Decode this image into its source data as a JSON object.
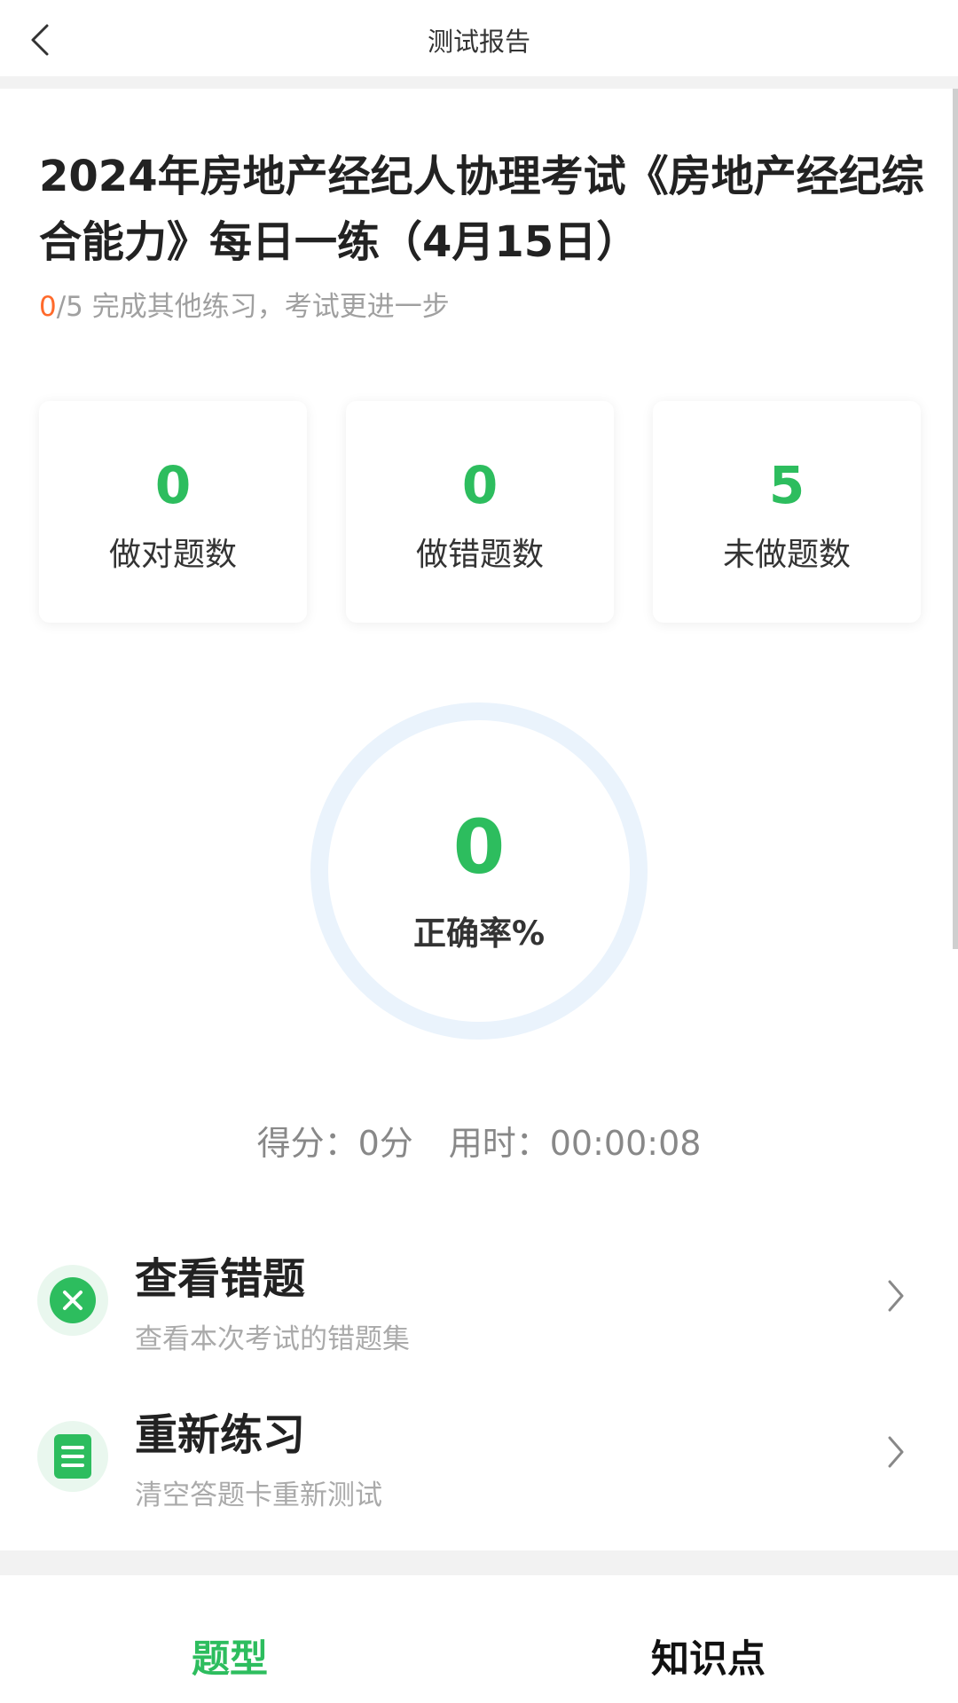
{
  "header": {
    "title": "测试报告"
  },
  "exam": {
    "title": "2024年房地产经纪人协理考试《房地产经纪综合能力》每日一练（4月15日）",
    "progress_done": "0",
    "progress_rest": "/5 完成其他练习，考试更进一步"
  },
  "stats": [
    {
      "value": "0",
      "label": "做对题数"
    },
    {
      "value": "0",
      "label": "做错题数"
    },
    {
      "value": "5",
      "label": "未做题数"
    }
  ],
  "accuracy": {
    "value": "0",
    "label": "正确率%"
  },
  "summary": {
    "score": "得分：0分",
    "time": "用时：00:00:08"
  },
  "actions": [
    {
      "title": "查看错题",
      "subtitle": "查看本次考试的错题集",
      "icon": "close-circle-icon"
    },
    {
      "title": "重新练习",
      "subtitle": "清空答题卡重新测试",
      "icon": "document-icon"
    }
  ],
  "tabs": [
    {
      "label": "题型",
      "active": true
    },
    {
      "label": "知识点",
      "active": false
    }
  ],
  "colors": {
    "accent": "#2dbd5e",
    "highlight": "#ff6a2b",
    "ring": "#eaf3fc"
  }
}
